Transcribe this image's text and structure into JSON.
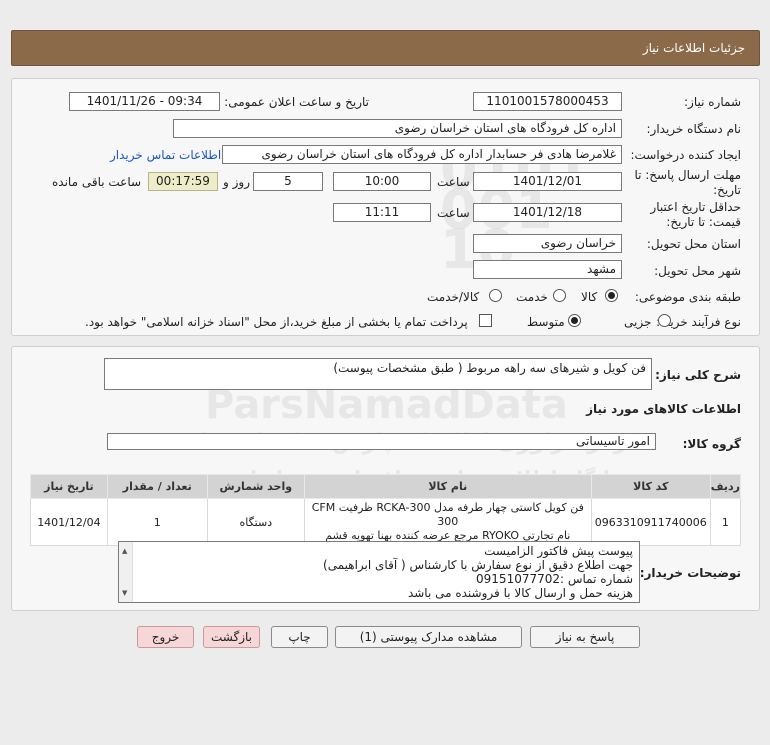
{
  "header": {
    "title": "جزئیات اطلاعات نیاز"
  },
  "form": {
    "need_number_label": "شماره نیاز:",
    "need_number": "1101001578000453",
    "announce_label": "تاریخ و ساعت اعلان عمومی:",
    "announce_value": "1401/11/26 - 09:34",
    "buyer_org_label": "نام دستگاه خریدار:",
    "buyer_org": "اداره کل فرودگاه های استان خراسان رضوی",
    "requester_label": "ایجاد کننده درخواست:",
    "requester": "غلامرضا هادی فر حسابدار اداره کل فرودگاه های استان خراسان رضوی",
    "contact_link": "اطلاعات تماس خریدار",
    "deadline_label_1": "مهلت ارسال پاسخ: تا",
    "deadline_label_2": "تاریخ:",
    "deadline_date": "1401/12/01",
    "time_label": "ساعت",
    "deadline_time": "10:00",
    "days_value": "5",
    "days_label": "روز و",
    "remaining_time": "00:17:59",
    "remaining_label": "ساعت باقی مانده",
    "validity_label_1": "حداقل تاریخ اعتبار",
    "validity_label_2": "قیمت: تا تاریخ:",
    "validity_date": "1401/12/18",
    "validity_time_label": "ساعت",
    "validity_time": "11:11",
    "province_label": "استان محل تحویل:",
    "province": "خراسان رضوی",
    "city_label": "شهر محل تحویل:",
    "city": "مشهد",
    "category_label": "طبقه بندی موضوعی:",
    "category_options": [
      "کالا",
      "خدمت",
      "کالا/خدمت"
    ],
    "process_label": "نوع فرآیند خرید :",
    "process_options": [
      "جزیی",
      "متوسط"
    ],
    "payment_note": "پرداخت تمام یا بخشی از مبلغ خرید،از محل \"اسناد خزانه اسلامی\" خواهد بود."
  },
  "summary": {
    "description_label": "شرح کلی نیاز:",
    "description": "فن کویل و شیرهای سه راهه مربوط ( طبق مشخصات  پیوست)",
    "goods_info_title": "اطلاعات کالاهای مورد نیاز",
    "goods_group_label": "گروه کالا:",
    "goods_group": "امور تاسیساتی"
  },
  "table": {
    "headers": [
      "ردیف",
      "کد کالا",
      "نام کالا",
      "واحد شمارش",
      "تعداد / مقدار",
      "تاریخ نیاز"
    ],
    "rows": [
      {
        "row": "1",
        "code": "0963310911740006",
        "name_line1": "فن کویل کاستی چهار طرفه مدل RCKA-300 ظرفیت CFM 300",
        "name_line2": "نام تجارتی RYOKO مرجع عرضه کننده بهنا تهویه قشم",
        "unit": "دستگاه",
        "qty": "1",
        "date": "1401/12/04"
      }
    ]
  },
  "notes": {
    "label": "توضیحات خریدار:",
    "lines": [
      "پیوست پیش فاکتور الزامیست",
      "جهت اطلاع دقیق از نوع سفارش با کارشناس   ( آقای ابراهیمی)",
      "شماره تماس :09151077702",
      "هزینه حمل و ارسال کالا با فروشنده می باشد"
    ]
  },
  "buttons": {
    "reply": "پاسخ به نیاز",
    "view_docs": "مشاهده مدارک پیوستی (1)",
    "print": "چاپ",
    "back": "بازگشت",
    "exit": "خروج"
  }
}
